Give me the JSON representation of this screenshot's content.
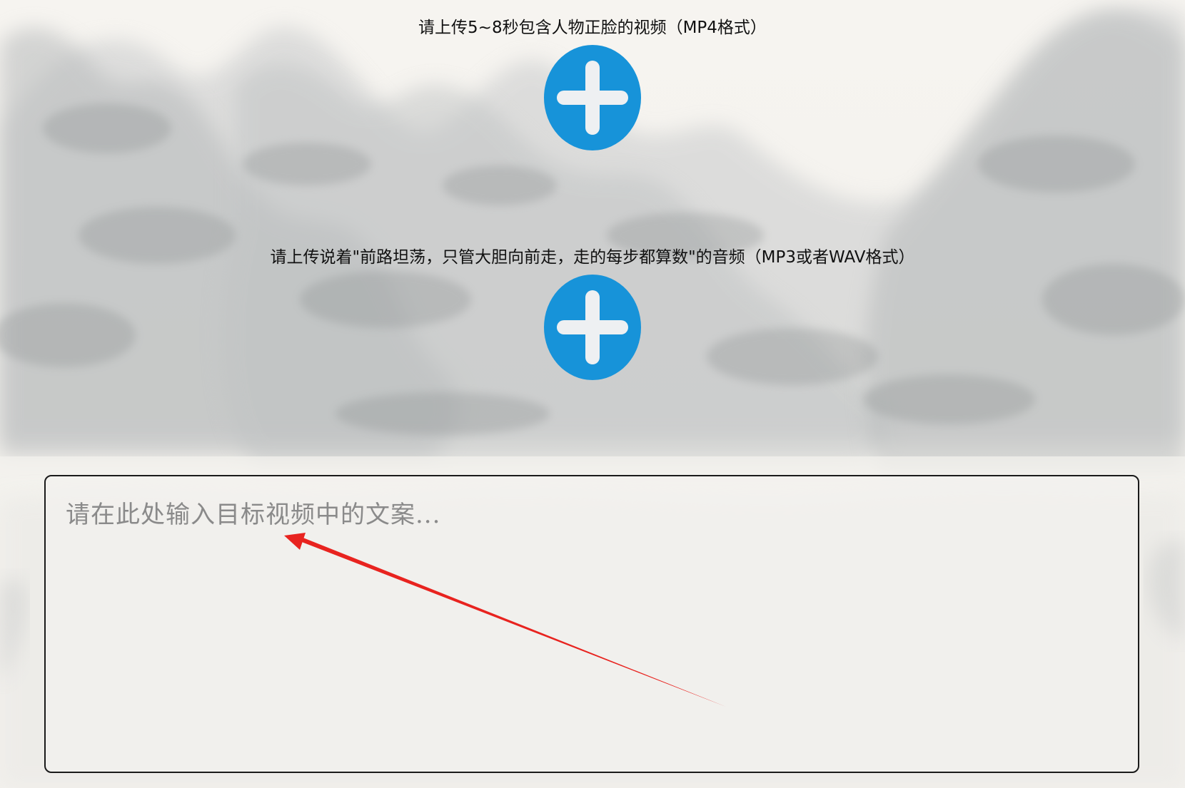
{
  "video_upload": {
    "label": "请上传5~8秒包含人物正脸的视频（MP4格式）",
    "icon": "plus-circle-icon"
  },
  "audio_upload": {
    "label": "请上传说着\"前路坦荡，只管大胆向前走，走的每步都算数\"的音频（MP3或者WAV格式）",
    "icon": "plus-circle-icon"
  },
  "copy_input": {
    "placeholder": "请在此处输入目标视频中的文案...",
    "value": ""
  },
  "colors": {
    "accent": "#1793d9",
    "annotation_arrow": "#e8231f",
    "background": "#f4f2ee"
  }
}
